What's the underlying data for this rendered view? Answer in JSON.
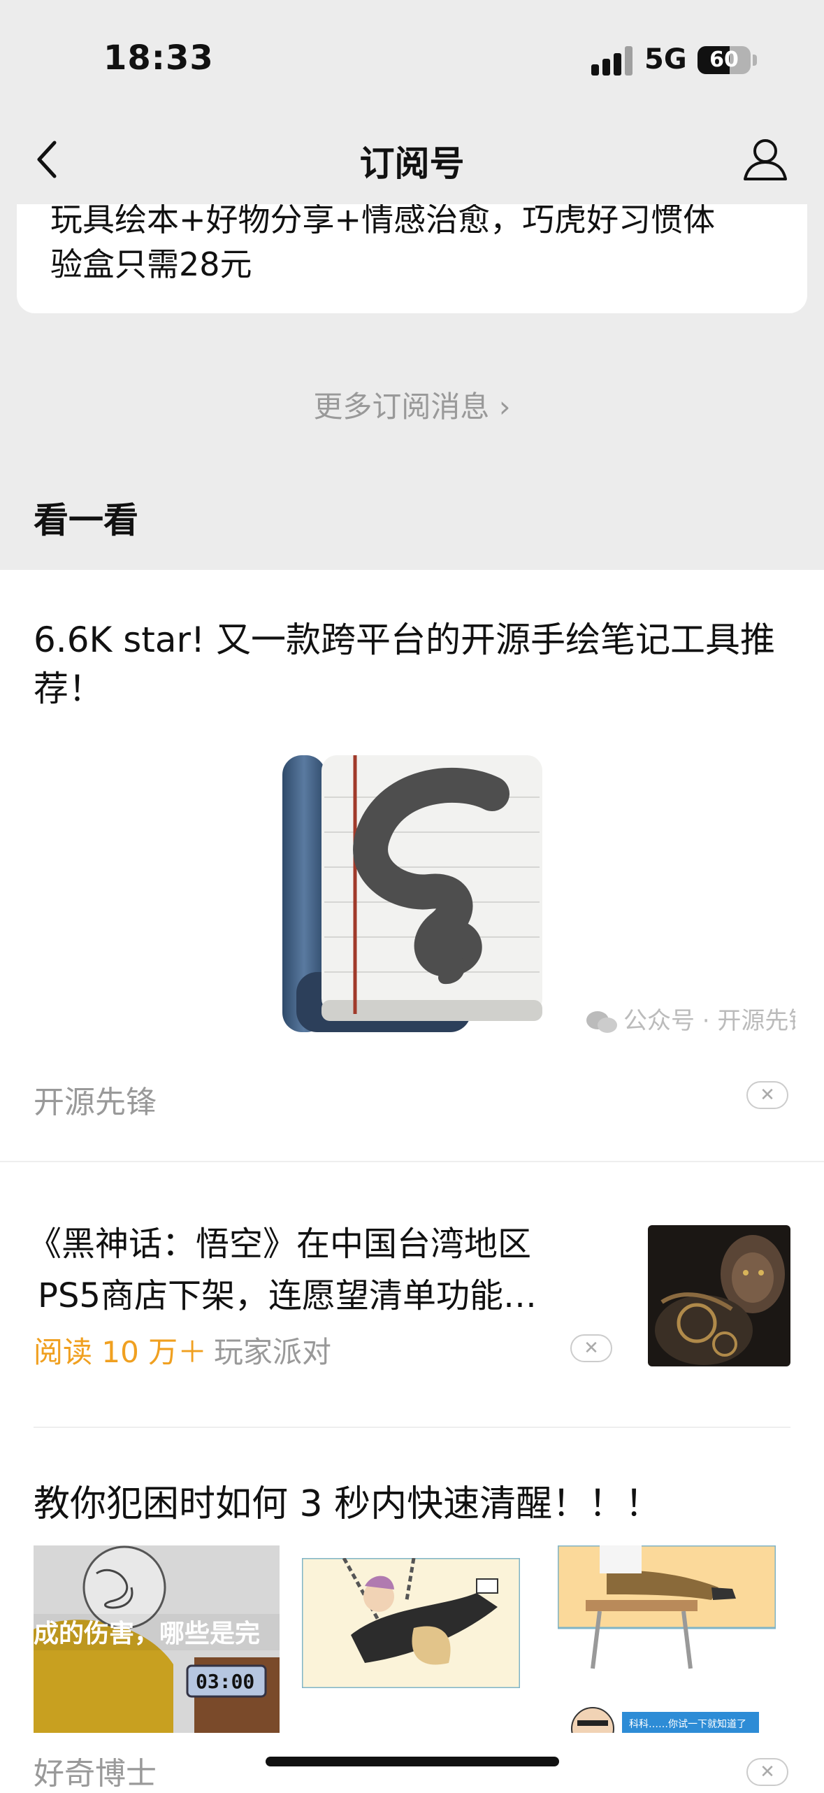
{
  "status_bar": {
    "time": "18:33",
    "network": "5G",
    "battery": "60",
    "battery_level": 0.6
  },
  "nav": {
    "title": "订阅号"
  },
  "top_card": {
    "line1": "玩具绘本+好物分享+情感治愈，巧虎好习惯体",
    "line2": "验盒只需28元"
  },
  "more_link": "更多订阅消息 ›",
  "section_title": "看一看",
  "articles": [
    {
      "title": "6.6K star! 又一款跨平台的开源手绘笔记工具推荐！",
      "watermark": "公众号 · 开源先锋",
      "source": "开源先锋",
      "close": "✕"
    },
    {
      "title_line1": "《黑神话：悟空》在中国台湾地区",
      "title_line2": "PS5商店下架，连愿望清单功能…",
      "reads": "阅读 10 万＋",
      "source": "玩家派对",
      "close": "✕"
    },
    {
      "title": "教你犯困时如何 3 秒内快速清醒！！！",
      "img1_caption": "成的伤害，哪些是完",
      "img1_clock": "03:00",
      "img3_caption": "科科……你试一下就知道了",
      "source": "好奇博士",
      "close": "✕"
    }
  ],
  "colors": {
    "accent_reads": "#f0a020",
    "gray_bg": "#ececec",
    "muted_text": "#999999"
  }
}
